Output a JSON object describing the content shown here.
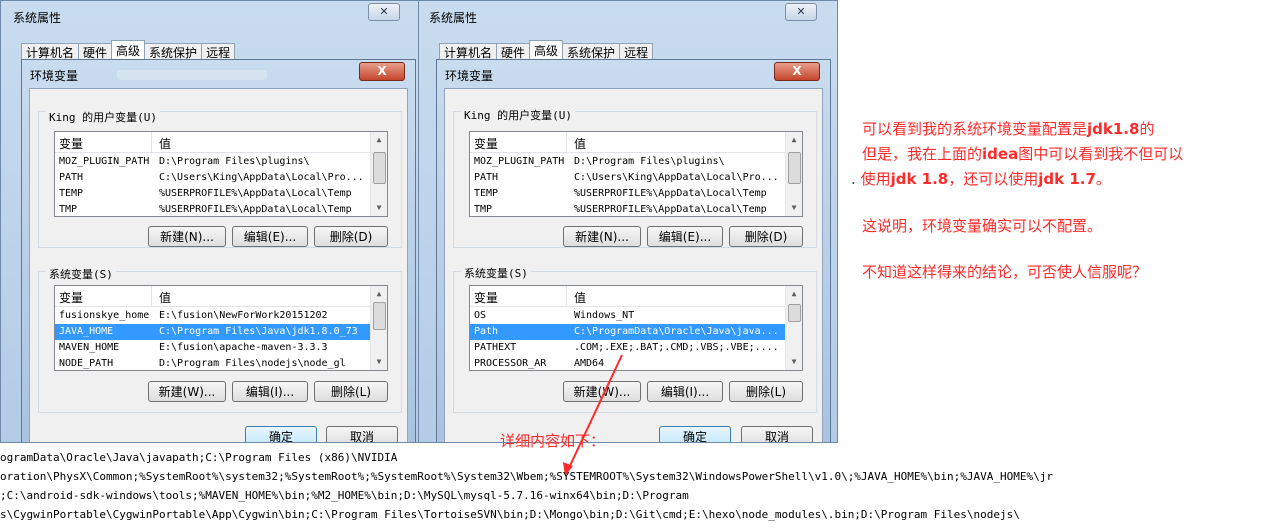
{
  "left": {
    "window_title": "系统属性",
    "tabs": [
      "计算机名",
      "硬件",
      "高级",
      "系统保护",
      "远程"
    ],
    "active_tab": 2,
    "dialog_title": "环境变量",
    "close_label": "X",
    "user_group_label": "King 的用户变量(U)",
    "col_variable": "变量",
    "col_value": "值",
    "user_vars": [
      {
        "name": "MOZ_PLUGIN_PATH",
        "value": "D:\\Program Files\\plugins\\"
      },
      {
        "name": "PATH",
        "value": "C:\\Users\\King\\AppData\\Local\\Pro..."
      },
      {
        "name": "TEMP",
        "value": "%USERPROFILE%\\AppData\\Local\\Temp"
      },
      {
        "name": "TMP",
        "value": "%USERPROFILE%\\AppData\\Local\\Temp"
      }
    ],
    "user_new": "新建(N)...",
    "user_edit": "编辑(E)...",
    "user_delete": "删除(D)",
    "sys_group_label": "系统变量(S)",
    "sys_vars": [
      {
        "name": "fusionskye_home",
        "value": "E:\\fusion\\NewForWork20151202"
      },
      {
        "name": "JAVA_HOME",
        "value": "C:\\Program Files\\Java\\jdk1.8.0_73"
      },
      {
        "name": "MAVEN_HOME",
        "value": "E:\\fusion\\apache-maven-3.3.3"
      },
      {
        "name": "NODE_PATH",
        "value": "D:\\Program Files\\nodejs\\node_gl"
      }
    ],
    "sys_selected": 1,
    "sys_new": "新建(W)...",
    "sys_edit": "编辑(I)...",
    "sys_delete": "删除(L)",
    "ok": "确定",
    "cancel": "取消"
  },
  "right": {
    "window_title": "系统属性",
    "tabs": [
      "计算机名",
      "硬件",
      "高级",
      "系统保护",
      "远程"
    ],
    "active_tab": 2,
    "dialog_title": "环境变量",
    "close_label": "X",
    "user_group_label": "King 的用户变量(U)",
    "col_variable": "变量",
    "col_value": "值",
    "user_vars": [
      {
        "name": "MOZ_PLUGIN_PATH",
        "value": "D:\\Program Files\\plugins\\"
      },
      {
        "name": "PATH",
        "value": "C:\\Users\\King\\AppData\\Local\\Pro..."
      },
      {
        "name": "TEMP",
        "value": "%USERPROFILE%\\AppData\\Local\\Temp"
      },
      {
        "name": "TMP",
        "value": "%USERPROFILE%\\AppData\\Local\\Temp"
      }
    ],
    "user_new": "新建(N)...",
    "user_edit": "编辑(E)...",
    "user_delete": "删除(D)",
    "sys_group_label": "系统变量(S)",
    "sys_vars": [
      {
        "name": "OS",
        "value": "Windows_NT"
      },
      {
        "name": "Path",
        "value": "C:\\ProgramData\\Oracle\\Java\\java..."
      },
      {
        "name": "PATHEXT",
        "value": ".COM;.EXE;.BAT;.CMD;.VBS;.VBE;...."
      },
      {
        "name": "PROCESSOR_AR",
        "value": "AMD64"
      }
    ],
    "sys_selected": 1,
    "sys_new": "新建(W)...",
    "sys_edit": "编辑(I)...",
    "sys_delete": "删除(L)",
    "ok": "确定",
    "cancel": "取消"
  },
  "annotations": {
    "line1_a": "可以看到我的系统环境变量配置是",
    "line1_b": "jdk1.8",
    "line1_c": "的",
    "line2_a": "但是，我在上面的",
    "line2_b": "idea",
    "line2_c": "图中可以看到我不但可以",
    "line3_a": "使用",
    "line3_b": "jdk 1.8",
    "line3_c": "，还可以使用",
    "line3_d": "jdk 1.7",
    "line3_e": "。",
    "line4": "这说明，环境变量确实可以不配置。",
    "line5": "不知道这样得来的结论，可否使人信服呢？",
    "detail_label": "详细内容如下：",
    "arrow_color": "#ff2a2a"
  },
  "path_detail": [
    "ogramData\\Oracle\\Java\\javapath;C:\\Program Files (x86)\\NVIDIA",
    "oration\\PhysX\\Common;%SystemRoot%\\system32;%SystemRoot%;%SystemRoot%\\System32\\Wbem;%SYSTEMROOT%\\System32\\WindowsPowerShell\\v1.0\\;%JAVA_HOME%\\bin;%JAVA_HOME%\\jr",
    ";C:\\android-sdk-windows\\tools;%MAVEN_HOME%\\bin;%M2_HOME%\\bin;D:\\MySQL\\mysql-5.7.16-winx64\\bin;D:\\Program",
    "s\\CygwinPortable\\CygwinPortable\\App\\Cygwin\\bin;C:\\Program Files\\TortoiseSVN\\bin;D:\\Mongo\\bin;D:\\Git\\cmd;E:\\hexo\\node_modules\\.bin;D:\\Program Files\\nodejs\\"
  ]
}
